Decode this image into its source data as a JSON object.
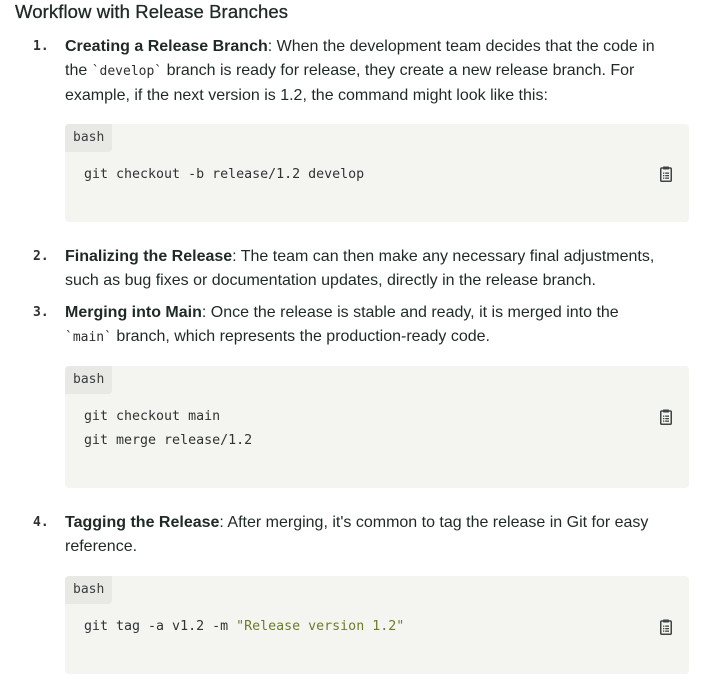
{
  "heading": "Workflow with Release Branches",
  "steps": [
    {
      "number": "1.",
      "title": "Creating a Release Branch",
      "text_line1_rest": ": When the development team decides that the code in",
      "text_line2_pre": "the ",
      "code_inline": "`develop`",
      "text_line2_post": " branch is ready for release, they create a new release branch. For",
      "text_line3": "example, if the next version is 1.2, the command might look like this:",
      "codeblock": {
        "lang": "bash",
        "lines": [
          "git checkout -b release/1.2 develop"
        ]
      }
    },
    {
      "number": "2.",
      "title": "Finalizing the Release",
      "text_line1_rest": ": The team can then make any necessary final adjustments,",
      "text_line2": "such as bug fixes or documentation updates, directly in the release branch."
    },
    {
      "number": "3.",
      "title": "Merging into Main",
      "text_line1_rest": ": Once the release is stable and ready, it is merged into the",
      "code_inline": "`main`",
      "text_line2_post": " branch, which represents the production-ready code.",
      "codeblock": {
        "lang": "bash",
        "lines": [
          "git checkout main",
          "git merge release/1.2"
        ]
      }
    },
    {
      "number": "4.",
      "title": "Tagging the Release",
      "text_line1_rest": ": After merging, it's common to tag the release in Git for easy",
      "text_line2": "reference.",
      "codeblock": {
        "lang": "bash",
        "code_prefix": "git tag -a v1.2 -m ",
        "code_string": "\"Release version 1.2\""
      }
    }
  ],
  "colors": {
    "text": "#1f2a24",
    "code_bg": "#f4f4f1",
    "lang_tag_bg": "#e8e8e4",
    "string": "#6b7d2a"
  },
  "icons": {
    "copy": "clipboard-icon"
  }
}
